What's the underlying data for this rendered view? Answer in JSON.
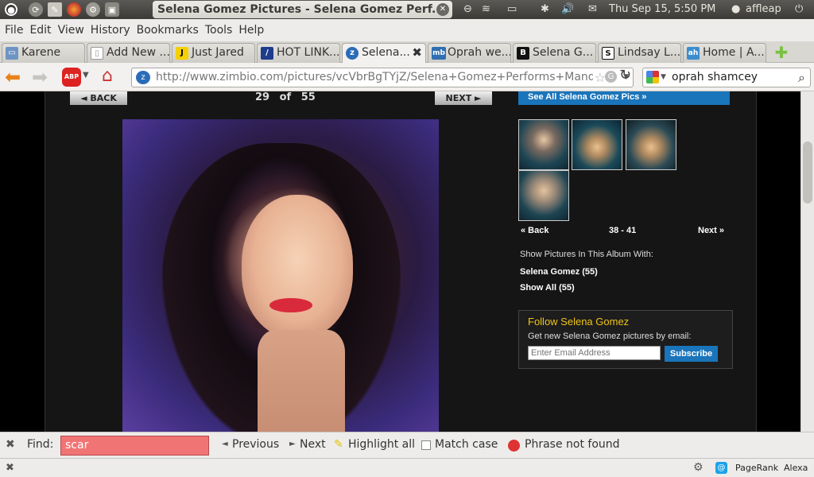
{
  "panel": {
    "window_title": "Selena Gomez Pictures - Selena Gomez Perf...",
    "clock": "Thu Sep 15,  5:50 PM",
    "user": "affleap"
  },
  "menu": [
    "File",
    "Edit",
    "View",
    "History",
    "Bookmarks",
    "Tools",
    "Help"
  ],
  "tabs": [
    {
      "label": "Karene",
      "color": "#6d94c4",
      "glyph": "▭"
    },
    {
      "label": "Add New ...",
      "color": "#bdbdbd",
      "glyph": "▯"
    },
    {
      "label": "Just Jared",
      "color": "#f5d000",
      "glyph": "J"
    },
    {
      "label": "HOT LINK...",
      "color": "#1e3c8c",
      "glyph": "/"
    },
    {
      "label": "Selena...",
      "color": "#2b6cb8",
      "glyph": "z",
      "active": true
    },
    {
      "label": "Oprah we...",
      "color": "#2f6fb2",
      "glyph": "mb"
    },
    {
      "label": "Selena G...",
      "color": "#111111",
      "glyph": "B"
    },
    {
      "label": "Lindsay L...",
      "color": "#111111",
      "glyph": "S"
    },
    {
      "label": "Home | A...",
      "color": "#3a8dd0",
      "glyph": "ah"
    }
  ],
  "nav": {
    "url_host": "http://www.zimbio.com",
    "url_path": "/pictures/vcVbrBgTYjZ/Selena+Gomez+Performs+Manda",
    "search_query": "oprah shamcey"
  },
  "page": {
    "back_label": "◄ BACK",
    "next_label": "NEXT ►",
    "counter_current": "29",
    "counter_of": "of",
    "counter_total": "55",
    "see_all": "See All Selena Gomez Pics »",
    "thumb_back": "« Back",
    "thumb_range": "38 - 41",
    "thumb_next": "Next »",
    "album_heading": "Show Pictures In This Album With:",
    "album_link1": "Selena Gomez (55)",
    "album_link2": "Show All (55)",
    "follow_title": "Follow Selena Gomez",
    "follow_desc": "Get new Selena Gomez pictures by email:",
    "email_placeholder": "Enter Email Address",
    "subscribe": "Subscribe"
  },
  "find": {
    "label": "Find:",
    "value": "scar",
    "previous": "Previous",
    "next": "Next",
    "highlight": "Highlight all",
    "matchcase": "Match case",
    "status": "Phrase not found"
  },
  "status": {
    "pagerank": "PageRank",
    "alexa": "Alexa"
  },
  "colors": {
    "find_error": "#f17474",
    "link_blue": "#1a75bb",
    "follow_title": "#f0c419"
  }
}
